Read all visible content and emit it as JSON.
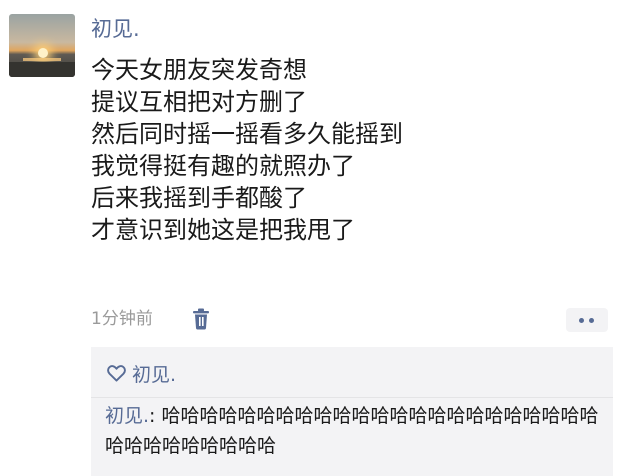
{
  "post": {
    "author": "初见.",
    "lines": [
      "今天女朋友突发奇想",
      "提议互相把对方删了",
      "然后同时摇一摇看多久能摇到",
      "我觉得挺有趣的就照办了",
      "后来我摇到手都酸了",
      "才意识到她这是把我甩了"
    ],
    "time": "1分钟前"
  },
  "likes": {
    "names": "初见."
  },
  "comments": [
    {
      "author": "初见.",
      "separator": ": ",
      "text": "哈哈哈哈哈哈哈哈哈哈哈哈哈哈哈哈哈哈哈哈哈哈哈哈哈哈哈哈哈哈哈哈"
    }
  ],
  "colors": {
    "link": "#576b95",
    "text": "#1a1a1a",
    "meta": "#9a9a9a",
    "panel": "#f3f3f5"
  },
  "icons": [
    "trash-icon",
    "more-dots-icon",
    "heart-outline-icon"
  ]
}
